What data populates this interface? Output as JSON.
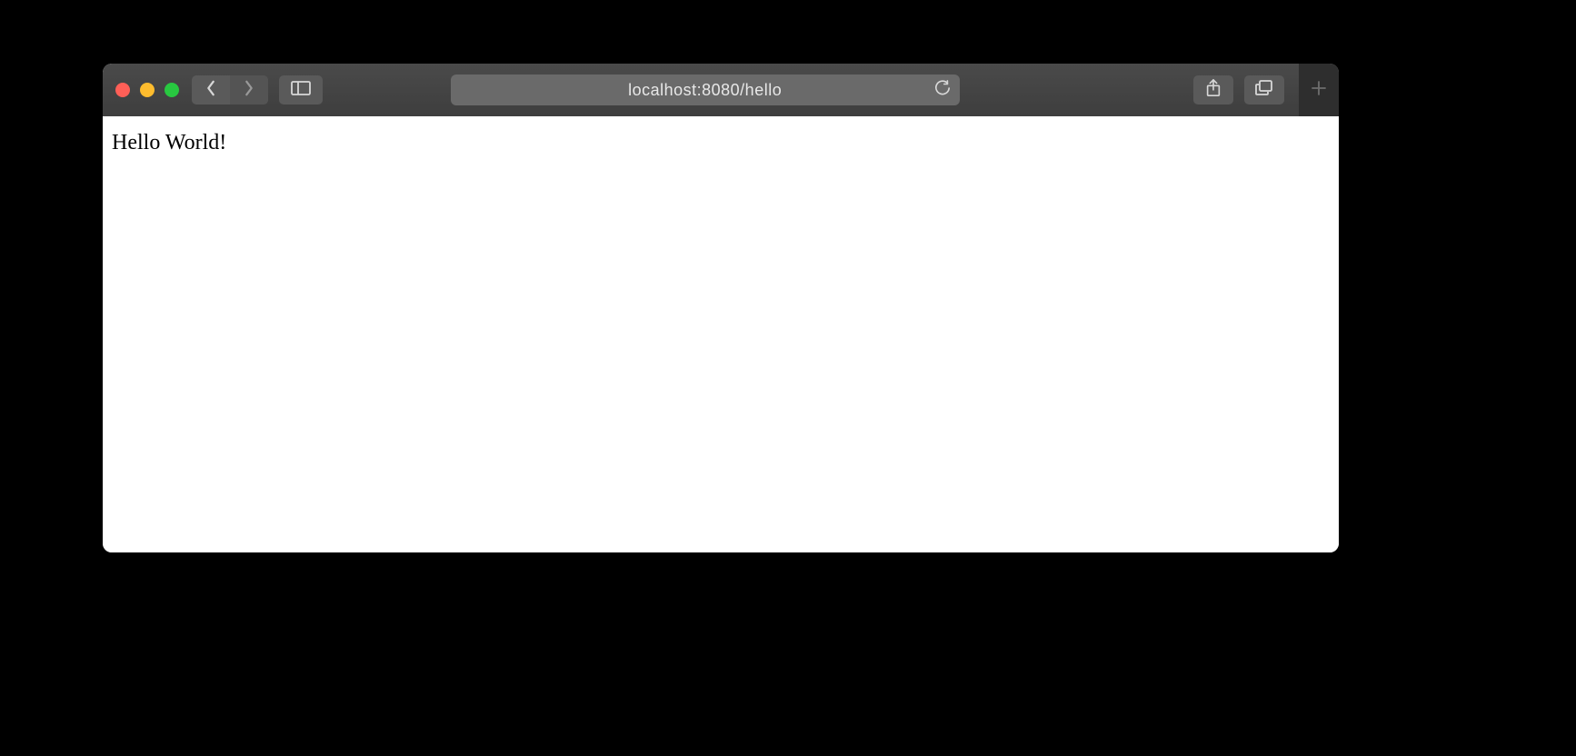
{
  "address_bar": {
    "url": "localhost:8080/hello"
  },
  "page": {
    "body_text": "Hello World!"
  }
}
